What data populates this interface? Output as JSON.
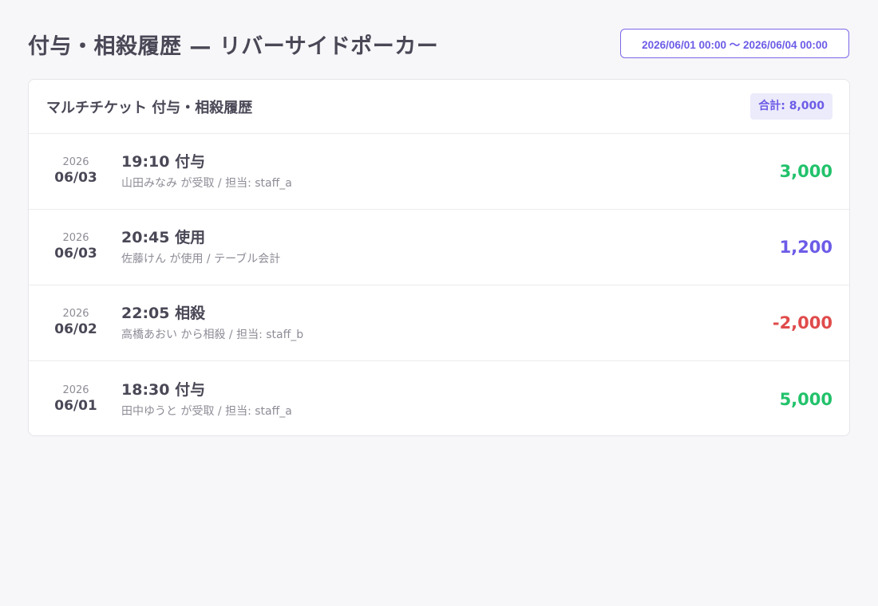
{
  "header": {
    "title": "付与・相殺履歴 — リバーサイドポーカー",
    "date_range": "2026/06/01 00:00 〜 2026/06/04 00:00"
  },
  "card": {
    "title": "マルチチケット 付与・相殺履歴",
    "total_label": "合計: 8,000"
  },
  "entries": [
    {
      "year": "2026",
      "date": "06/03",
      "title": "19:10 付与",
      "detail": "山田みなみ が受取 / 担当: staff_a",
      "amount": "3,000",
      "amount_color": "#22c26b"
    },
    {
      "year": "2026",
      "date": "06/03",
      "title": "20:45 使用",
      "detail": "佐藤けん が使用 / テーブル会計",
      "amount": "1,200",
      "amount_color": "#6c5ce7"
    },
    {
      "year": "2026",
      "date": "06/02",
      "title": "22:05 相殺",
      "detail": "高橋あおい から相殺 / 担当: staff_b",
      "amount": "-2,000",
      "amount_color": "#e04b4b"
    },
    {
      "year": "2026",
      "date": "06/01",
      "title": "18:30 付与",
      "detail": "田中ゆうと が受取 / 担当: staff_a",
      "amount": "5,000",
      "amount_color": "#22c26b"
    }
  ]
}
